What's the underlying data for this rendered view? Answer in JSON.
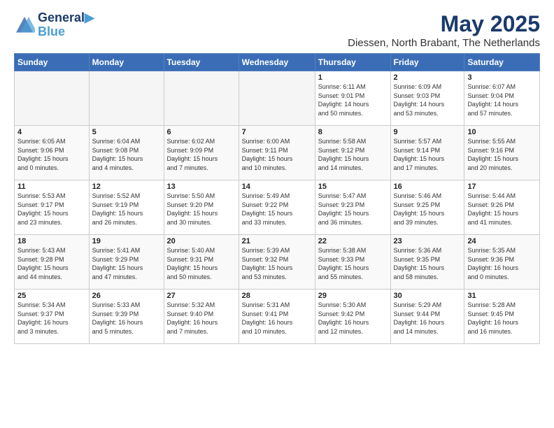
{
  "header": {
    "logo_line1": "General",
    "logo_line2": "Blue",
    "title": "May 2025",
    "subtitle": "Diessen, North Brabant, The Netherlands"
  },
  "columns": [
    "Sunday",
    "Monday",
    "Tuesday",
    "Wednesday",
    "Thursday",
    "Friday",
    "Saturday"
  ],
  "weeks": [
    [
      {
        "day": "",
        "info": ""
      },
      {
        "day": "",
        "info": ""
      },
      {
        "day": "",
        "info": ""
      },
      {
        "day": "",
        "info": ""
      },
      {
        "day": "1",
        "info": "Sunrise: 6:11 AM\nSunset: 9:01 PM\nDaylight: 14 hours\nand 50 minutes."
      },
      {
        "day": "2",
        "info": "Sunrise: 6:09 AM\nSunset: 9:03 PM\nDaylight: 14 hours\nand 53 minutes."
      },
      {
        "day": "3",
        "info": "Sunrise: 6:07 AM\nSunset: 9:04 PM\nDaylight: 14 hours\nand 57 minutes."
      }
    ],
    [
      {
        "day": "4",
        "info": "Sunrise: 6:05 AM\nSunset: 9:06 PM\nDaylight: 15 hours\nand 0 minutes."
      },
      {
        "day": "5",
        "info": "Sunrise: 6:04 AM\nSunset: 9:08 PM\nDaylight: 15 hours\nand 4 minutes."
      },
      {
        "day": "6",
        "info": "Sunrise: 6:02 AM\nSunset: 9:09 PM\nDaylight: 15 hours\nand 7 minutes."
      },
      {
        "day": "7",
        "info": "Sunrise: 6:00 AM\nSunset: 9:11 PM\nDaylight: 15 hours\nand 10 minutes."
      },
      {
        "day": "8",
        "info": "Sunrise: 5:58 AM\nSunset: 9:12 PM\nDaylight: 15 hours\nand 14 minutes."
      },
      {
        "day": "9",
        "info": "Sunrise: 5:57 AM\nSunset: 9:14 PM\nDaylight: 15 hours\nand 17 minutes."
      },
      {
        "day": "10",
        "info": "Sunrise: 5:55 AM\nSunset: 9:16 PM\nDaylight: 15 hours\nand 20 minutes."
      }
    ],
    [
      {
        "day": "11",
        "info": "Sunrise: 5:53 AM\nSunset: 9:17 PM\nDaylight: 15 hours\nand 23 minutes."
      },
      {
        "day": "12",
        "info": "Sunrise: 5:52 AM\nSunset: 9:19 PM\nDaylight: 15 hours\nand 26 minutes."
      },
      {
        "day": "13",
        "info": "Sunrise: 5:50 AM\nSunset: 9:20 PM\nDaylight: 15 hours\nand 30 minutes."
      },
      {
        "day": "14",
        "info": "Sunrise: 5:49 AM\nSunset: 9:22 PM\nDaylight: 15 hours\nand 33 minutes."
      },
      {
        "day": "15",
        "info": "Sunrise: 5:47 AM\nSunset: 9:23 PM\nDaylight: 15 hours\nand 36 minutes."
      },
      {
        "day": "16",
        "info": "Sunrise: 5:46 AM\nSunset: 9:25 PM\nDaylight: 15 hours\nand 39 minutes."
      },
      {
        "day": "17",
        "info": "Sunrise: 5:44 AM\nSunset: 9:26 PM\nDaylight: 15 hours\nand 41 minutes."
      }
    ],
    [
      {
        "day": "18",
        "info": "Sunrise: 5:43 AM\nSunset: 9:28 PM\nDaylight: 15 hours\nand 44 minutes."
      },
      {
        "day": "19",
        "info": "Sunrise: 5:41 AM\nSunset: 9:29 PM\nDaylight: 15 hours\nand 47 minutes."
      },
      {
        "day": "20",
        "info": "Sunrise: 5:40 AM\nSunset: 9:31 PM\nDaylight: 15 hours\nand 50 minutes."
      },
      {
        "day": "21",
        "info": "Sunrise: 5:39 AM\nSunset: 9:32 PM\nDaylight: 15 hours\nand 53 minutes."
      },
      {
        "day": "22",
        "info": "Sunrise: 5:38 AM\nSunset: 9:33 PM\nDaylight: 15 hours\nand 55 minutes."
      },
      {
        "day": "23",
        "info": "Sunrise: 5:36 AM\nSunset: 9:35 PM\nDaylight: 15 hours\nand 58 minutes."
      },
      {
        "day": "24",
        "info": "Sunrise: 5:35 AM\nSunset: 9:36 PM\nDaylight: 16 hours\nand 0 minutes."
      }
    ],
    [
      {
        "day": "25",
        "info": "Sunrise: 5:34 AM\nSunset: 9:37 PM\nDaylight: 16 hours\nand 3 minutes."
      },
      {
        "day": "26",
        "info": "Sunrise: 5:33 AM\nSunset: 9:39 PM\nDaylight: 16 hours\nand 5 minutes."
      },
      {
        "day": "27",
        "info": "Sunrise: 5:32 AM\nSunset: 9:40 PM\nDaylight: 16 hours\nand 7 minutes."
      },
      {
        "day": "28",
        "info": "Sunrise: 5:31 AM\nSunset: 9:41 PM\nDaylight: 16 hours\nand 10 minutes."
      },
      {
        "day": "29",
        "info": "Sunrise: 5:30 AM\nSunset: 9:42 PM\nDaylight: 16 hours\nand 12 minutes."
      },
      {
        "day": "30",
        "info": "Sunrise: 5:29 AM\nSunset: 9:44 PM\nDaylight: 16 hours\nand 14 minutes."
      },
      {
        "day": "31",
        "info": "Sunrise: 5:28 AM\nSunset: 9:45 PM\nDaylight: 16 hours\nand 16 minutes."
      }
    ]
  ]
}
